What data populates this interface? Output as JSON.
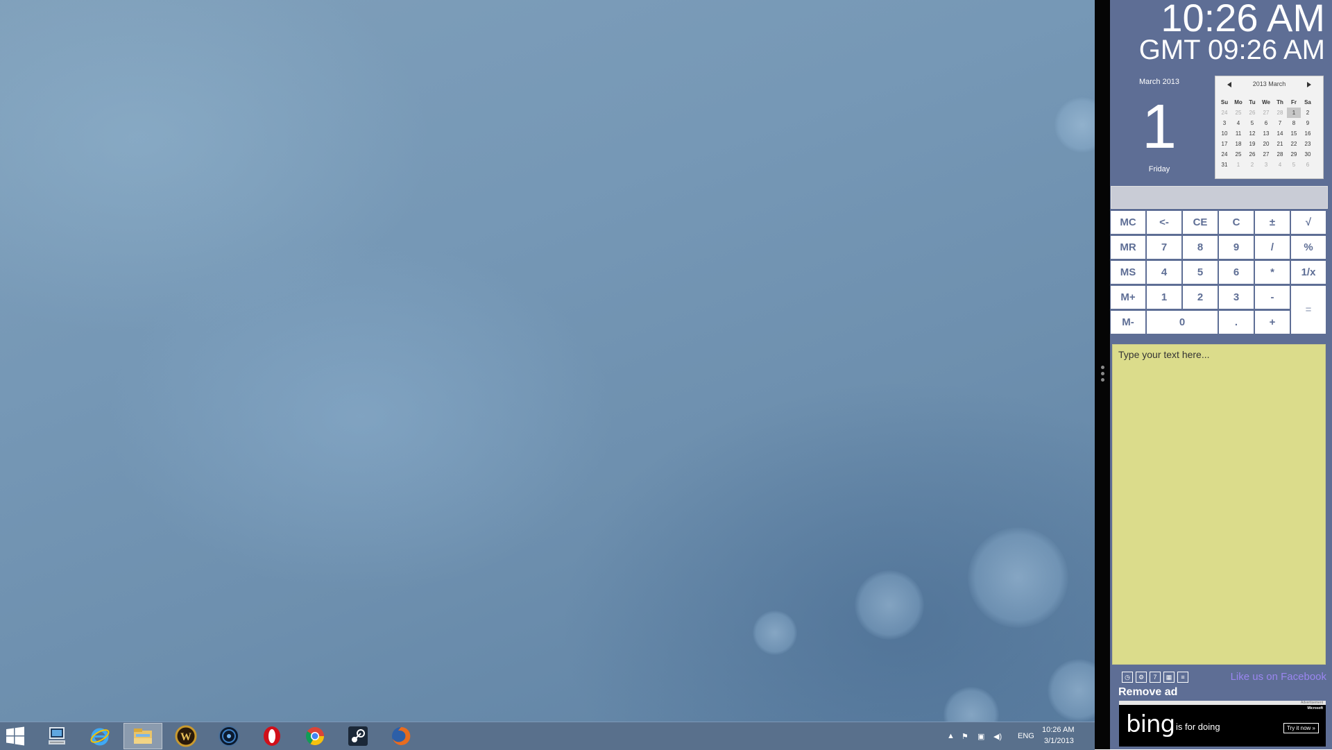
{
  "clock": {
    "local_time": "10:26 AM",
    "gmt_time": "GMT 09:26 AM"
  },
  "date_widget": {
    "month_year": "March 2013",
    "day": "1",
    "weekday": "Friday"
  },
  "calendar": {
    "header": "2013 March",
    "weekdays": [
      "Su",
      "Mo",
      "Tu",
      "We",
      "Th",
      "Fr",
      "Sa"
    ],
    "weeks": [
      [
        "24",
        "25",
        "26",
        "27",
        "28",
        "1",
        "2"
      ],
      [
        "3",
        "4",
        "5",
        "6",
        "7",
        "8",
        "9"
      ],
      [
        "10",
        "11",
        "12",
        "13",
        "14",
        "15",
        "16"
      ],
      [
        "17",
        "18",
        "19",
        "20",
        "21",
        "22",
        "23"
      ],
      [
        "24",
        "25",
        "26",
        "27",
        "28",
        "29",
        "30"
      ],
      [
        "31",
        "1",
        "2",
        "3",
        "4",
        "5",
        "6"
      ]
    ],
    "selected": "1"
  },
  "calculator": {
    "display": "",
    "keys": {
      "mc": "MC",
      "back": "<-",
      "ce": "CE",
      "c": "C",
      "pm": "±",
      "sqrt": "√",
      "mr": "MR",
      "n7": "7",
      "n8": "8",
      "n9": "9",
      "div": "/",
      "pct": "%",
      "ms": "MS",
      "n4": "4",
      "n5": "5",
      "n6": "6",
      "mul": "*",
      "inv": "1/x",
      "mplus": "M+",
      "n1": "1",
      "n2": "2",
      "n3": "3",
      "sub": "-",
      "eq": "=",
      "mminus": "M-",
      "n0": "0",
      "dot": ".",
      "add": "+"
    }
  },
  "notes": {
    "placeholder": "Type your text here..."
  },
  "links": {
    "facebook": "Like us on Facebook",
    "remove_ad": "Remove ad"
  },
  "ad": {
    "label": "Advertisement",
    "brand": "Microsoft",
    "logo": "bing",
    "tagline": "is for doing",
    "cta": "Try it now »"
  },
  "taskbar": {
    "apps": [
      "start-icon",
      "network-computer-icon",
      "internet-explorer-icon",
      "file-explorer-icon",
      "world-of-warcraft-icon",
      "globe-app-icon",
      "opera-icon",
      "chrome-icon",
      "steam-icon",
      "firefox-icon"
    ],
    "language": "ENG",
    "time": "10:26 AM",
    "date": "3/1/2013"
  }
}
